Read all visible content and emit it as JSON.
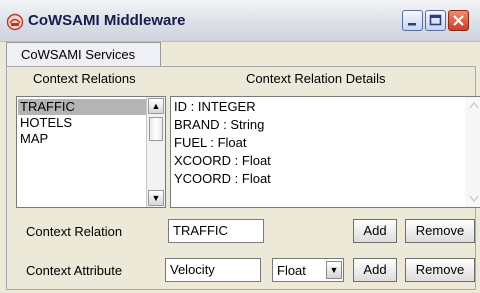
{
  "window": {
    "title": "CoWSAMI Middleware"
  },
  "tabs": [
    {
      "label": "CoWSAMI Services"
    }
  ],
  "headers": {
    "context_relations": "Context Relations",
    "context_relation_details": "Context Relation Details"
  },
  "relations": [
    {
      "label": "TRAFFIC",
      "selected": true
    },
    {
      "label": "HOTELS",
      "selected": false
    },
    {
      "label": "MAP",
      "selected": false
    }
  ],
  "details": [
    "ID : INTEGER",
    "BRAND : String",
    "FUEL : Float",
    "XCOORD : Float",
    "YCOORD : Float"
  ],
  "form": {
    "context_relation_label": "Context Relation",
    "context_relation_value": "TRAFFIC",
    "context_attribute_label": "Context Attribute",
    "context_attribute_value": "Velocity",
    "type_selected": "Float",
    "add_label": "Add",
    "remove_label": "Remove"
  }
}
